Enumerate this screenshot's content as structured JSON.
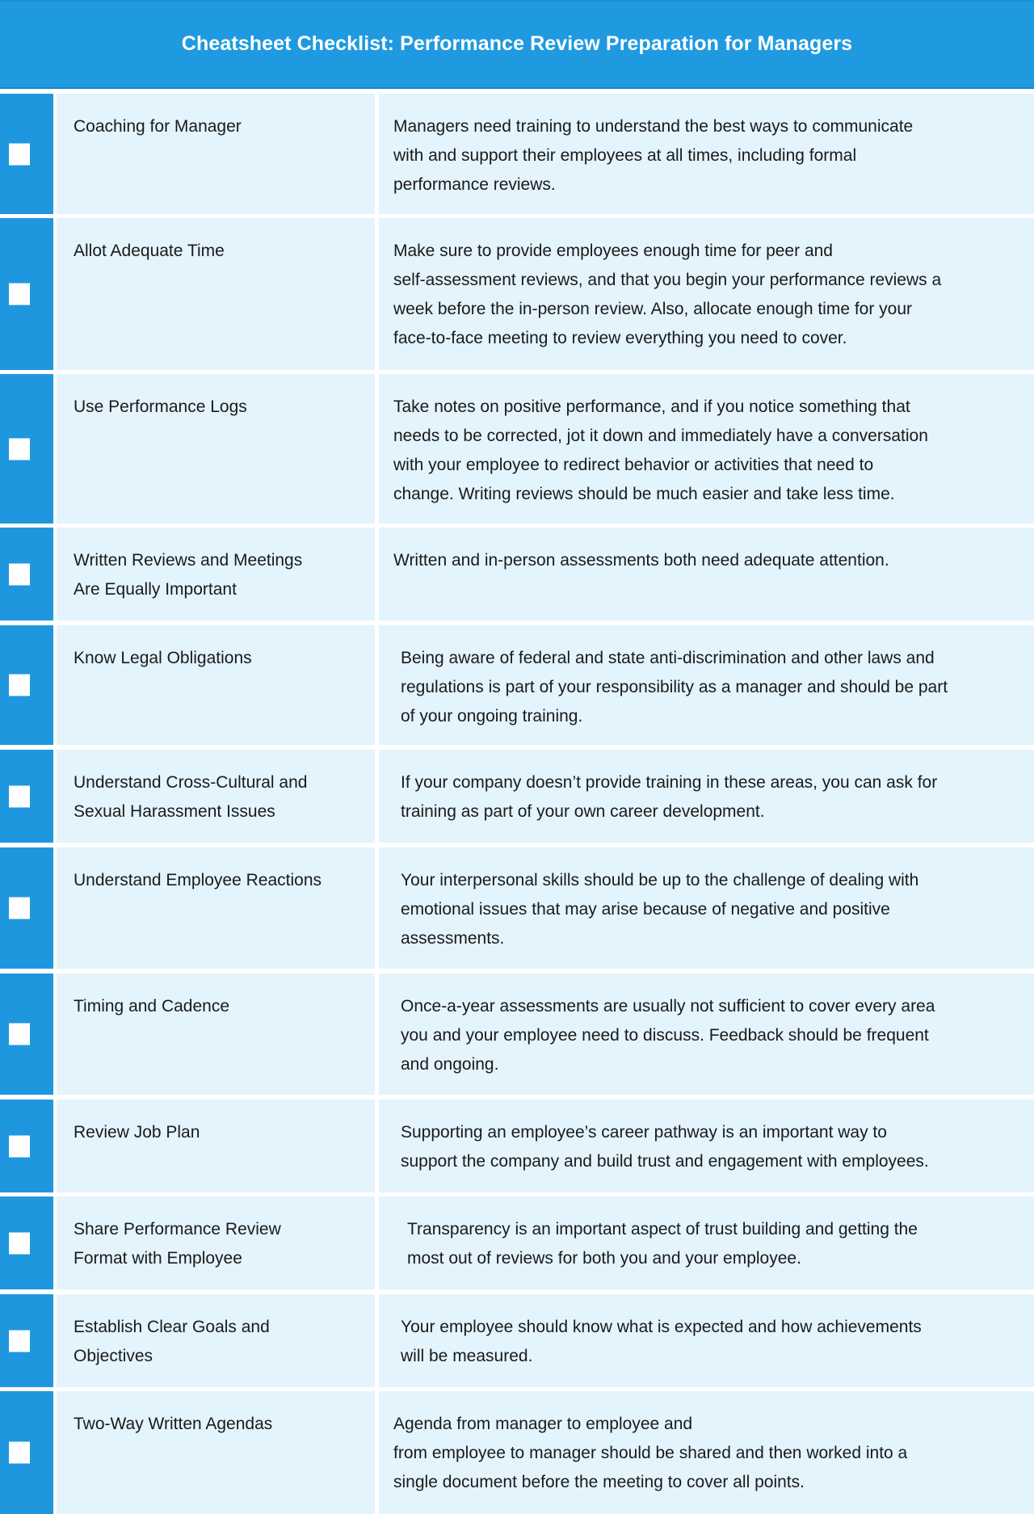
{
  "title": "Cheatsheet Checklist: Performance Review Preparation for Managers",
  "colors": {
    "header_blue": "#1f9ae0",
    "checkbox_column_blue": "#1f97df",
    "cell_background": "#e3f4fd",
    "text": "#1a1a1a"
  },
  "items": [
    {
      "label": "Coaching for Manager",
      "description": "Managers need training to understand the best ways to communicate\nwith and support their employees at all times, including formal\nperformance reviews.",
      "checked": false
    },
    {
      "label": "Allot Adequate Time",
      "description": "Make sure to provide employees enough time for peer and\nself-assessment reviews, and that you begin your performance reviews a\nweek before the in-person review. Also, allocate enough time for your\nface-to-face meeting to review everything you need to cover.",
      "checked": false
    },
    {
      "label": "Use Performance Logs",
      "description": "Take notes on positive performance, and if you notice something that\nneeds to be corrected, jot it down and immediately have a conversation\nwith your employee to redirect behavior or activities that need to\nchange. Writing reviews should be much easier and take less time.",
      "checked": false
    },
    {
      "label": "Written Reviews and Meetings\nAre Equally Important",
      "description": "Written and in-person assessments both need adequate attention.",
      "checked": false
    },
    {
      "label": "Know Legal Obligations",
      "description": "Being aware of federal and state anti-discrimination and other laws and\nregulations is part of your responsibility as a manager and should be part\nof your ongoing training.",
      "checked": false
    },
    {
      "label": "Understand Cross-Cultural and\nSexual Harassment Issues",
      "description": "If your company doesn’t provide training in these areas, you can ask for\ntraining as part of your own career development.",
      "checked": false
    },
    {
      "label": "Understand Employee Reactions",
      "description": "Your interpersonal skills should be up to the challenge of dealing with\nemotional issues that may arise because of negative and positive\nassessments.",
      "checked": false
    },
    {
      "label": "Timing and Cadence",
      "description": "Once-a-year assessments are usually not sufficient to cover every area\nyou and your employee need to discuss. Feedback should be frequent\nand ongoing.",
      "checked": false
    },
    {
      "label": "Review Job Plan",
      "description": "Supporting an employee’s career pathway is an important way to\nsupport the company and build trust and engagement with employees.",
      "checked": false
    },
    {
      "label": "Share Performance Review\nFormat with Employee",
      "description": "Transparency is an important aspect of trust building and getting the\nmost out of reviews for both you and your employee.",
      "checked": false
    },
    {
      "label": "Establish Clear Goals and\nObjectives",
      "description": "Your employee should know what is expected and how achievements\nwill be measured.",
      "checked": false
    },
    {
      "label": "Two-Way Written Agendas",
      "description": "Agenda from manager to employee and\nfrom employee to manager should be shared and then worked into a\nsingle document before the meeting to cover all points.",
      "checked": false
    }
  ]
}
